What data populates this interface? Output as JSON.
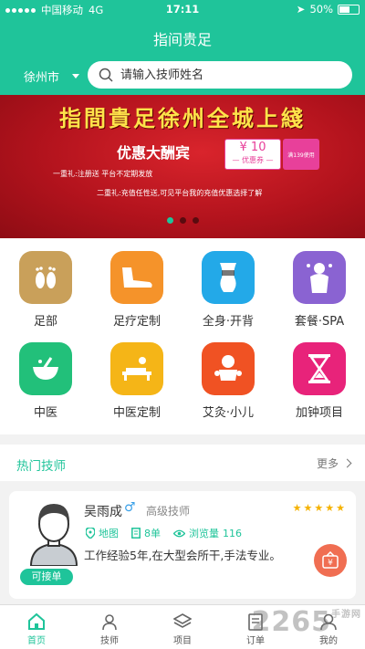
{
  "status": {
    "carrier": "中国移动",
    "network": "4G",
    "time": "17:11",
    "battery": "50%"
  },
  "header": {
    "title": "指间贵足",
    "city": "徐州市",
    "search_placeholder": "请输入技师姓名"
  },
  "banner": {
    "headline": "指間貴足徐州全城上綫",
    "subtitle": "优惠大酬宾",
    "coupon_amount": "¥ 10",
    "coupon_label": "— 优惠券 —",
    "coupon_condition": "满139使用",
    "line1": "一重礼:注册送  平台不定期发放",
    "line2": "二重礼:充值任性送,可见平台我的充值优惠选择了解",
    "active_dot": 0
  },
  "categories": [
    {
      "label": "足部",
      "icon": "feet-icon",
      "color": "#c9a05a"
    },
    {
      "label": "足疗定制",
      "icon": "foot-massage-icon",
      "color": "#f5932a"
    },
    {
      "label": "全身·开背",
      "icon": "body-icon",
      "color": "#23a9e8"
    },
    {
      "label": "套餐·SPA",
      "icon": "spa-icon",
      "color": "#8a63d2"
    },
    {
      "label": "中医",
      "icon": "mortar-icon",
      "color": "#22c07a"
    },
    {
      "label": "中医定制",
      "icon": "therapy-icon",
      "color": "#f5b517"
    },
    {
      "label": "艾灸·小儿",
      "icon": "baby-icon",
      "color": "#f05223"
    },
    {
      "label": "加钟项目",
      "icon": "hourglass-icon",
      "color": "#e8237a"
    }
  ],
  "hot": {
    "title": "热门技师",
    "more": "更多"
  },
  "technician": {
    "name": "吴雨成",
    "gender_symbol": "♂",
    "level": "高级技师",
    "rating": 5,
    "map_label": "地图",
    "orders": "8单",
    "views_label": "浏览量",
    "views": "116",
    "description": "工作经验5年,在大型会所干,手法专业。",
    "status": "可接单"
  },
  "tabs": [
    {
      "label": "首页",
      "icon": "home-icon",
      "active": true
    },
    {
      "label": "技师",
      "icon": "technician-icon",
      "active": false
    },
    {
      "label": "项目",
      "icon": "layers-icon",
      "active": false
    },
    {
      "label": "订单",
      "icon": "order-icon",
      "active": false
    },
    {
      "label": "我的",
      "icon": "user-icon",
      "active": false
    }
  ],
  "watermark": {
    "text": "2265",
    "sub": "手游网"
  },
  "colors": {
    "primary": "#1fc49a",
    "banner_red": "#c41a22",
    "headline_yellow": "#ffe34a"
  }
}
